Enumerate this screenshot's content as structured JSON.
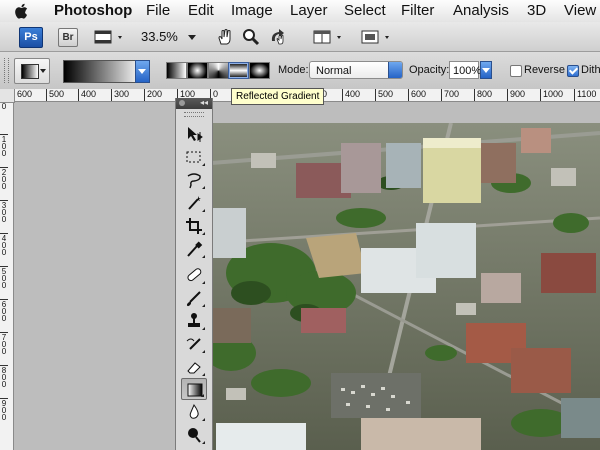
{
  "menubar": {
    "app_name": "Photoshop",
    "items": [
      "File",
      "Edit",
      "Image",
      "Layer",
      "Select",
      "Filter",
      "Analysis",
      "3D",
      "View"
    ]
  },
  "appbar": {
    "ps_label": "Ps",
    "br_label": "Br",
    "zoom": "33.5%"
  },
  "options": {
    "mode_label": "Mode:",
    "mode_value": "Normal",
    "opacity_label": "Opacity:",
    "opacity_value": "100%",
    "reverse_label": "Reverse",
    "reverse_checked": false,
    "dither_label": "Dithe",
    "dither_checked": true,
    "gradient_types": [
      "linear",
      "radial",
      "angle",
      "reflected",
      "diamond"
    ],
    "active_gradient_type": "reflected",
    "tooltip": "Reflected Gradient"
  },
  "rulers": {
    "horizontal": [
      "600",
      "500",
      "400",
      "300",
      "200",
      "100",
      "0",
      "100",
      "200",
      "300",
      "400",
      "500",
      "600",
      "700",
      "800",
      "900",
      "1000",
      "1100"
    ],
    "vertical": [
      "0",
      "1 0 0",
      "2 0 0",
      "3 0 0",
      "4 0 0",
      "5 0 0",
      "6 0 0",
      "7 0 0",
      "8 0 0",
      "9 0 0"
    ]
  },
  "tools": [
    "move-tool",
    "marquee-tool",
    "lasso-tool",
    "quick-select-tool",
    "crop-tool",
    "eyedropper-tool",
    "healing-brush-tool",
    "brush-tool",
    "clone-stamp-tool",
    "history-brush-tool",
    "eraser-tool",
    "gradient-tool",
    "blur-tool",
    "dodge-tool"
  ],
  "active_tool": "gradient-tool",
  "colors": {
    "accent_blue": "#2563c6",
    "tooltip_bg": "#ffffcc",
    "pasteboard": "#bdbdbd"
  }
}
